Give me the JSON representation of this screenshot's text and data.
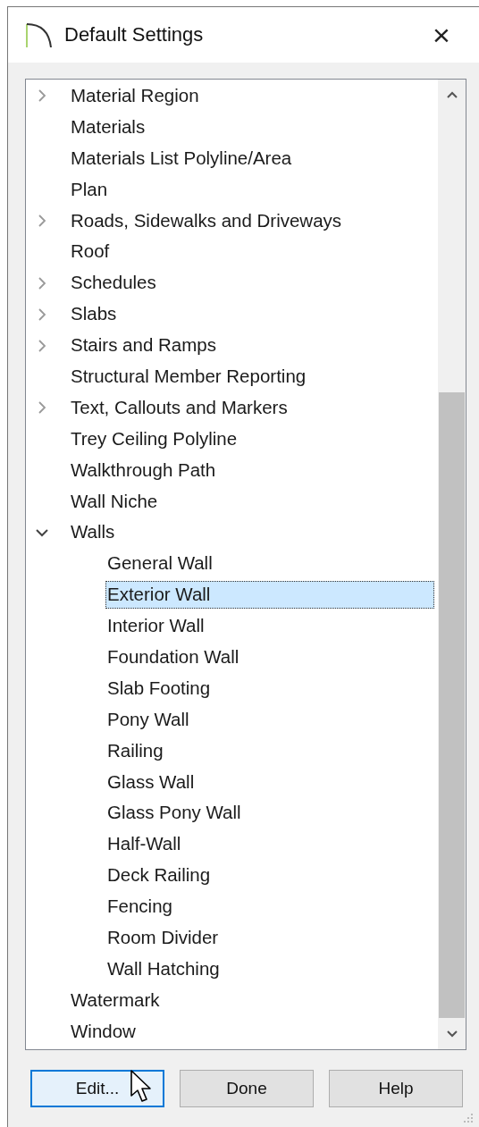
{
  "window": {
    "title": "Default Settings",
    "close": "×"
  },
  "tree": [
    {
      "label": "Material Region",
      "expanded": false,
      "selected": false
    },
    {
      "label": "Materials",
      "selected": false
    },
    {
      "label": "Materials List Polyline/Area",
      "selected": false
    },
    {
      "label": "Plan",
      "selected": false
    },
    {
      "label": "Roads, Sidewalks and Driveways",
      "expanded": false,
      "selected": false
    },
    {
      "label": "Roof",
      "selected": false
    },
    {
      "label": "Schedules",
      "expanded": false,
      "selected": false
    },
    {
      "label": "Slabs",
      "expanded": false,
      "selected": false
    },
    {
      "label": "Stairs and Ramps",
      "expanded": false,
      "selected": false
    },
    {
      "label": "Structural Member Reporting",
      "selected": false
    },
    {
      "label": "Text, Callouts and Markers",
      "expanded": false,
      "selected": false
    },
    {
      "label": "Trey Ceiling Polyline",
      "selected": false
    },
    {
      "label": "Walkthrough Path",
      "selected": false
    },
    {
      "label": "Wall Niche",
      "selected": false
    },
    {
      "label": "Walls",
      "expanded": true,
      "selected": false,
      "children": [
        {
          "label": "General Wall",
          "selected": false
        },
        {
          "label": "Exterior Wall",
          "selected": true
        },
        {
          "label": "Interior Wall",
          "selected": false
        },
        {
          "label": "Foundation Wall",
          "selected": false
        },
        {
          "label": "Slab Footing",
          "selected": false
        },
        {
          "label": "Pony Wall",
          "selected": false
        },
        {
          "label": "Railing",
          "selected": false
        },
        {
          "label": "Glass Wall",
          "selected": false
        },
        {
          "label": "Glass Pony Wall",
          "selected": false
        },
        {
          "label": "Half-Wall",
          "selected": false
        },
        {
          "label": "Deck Railing",
          "selected": false
        },
        {
          "label": "Fencing",
          "selected": false
        },
        {
          "label": "Room Divider",
          "selected": false
        },
        {
          "label": "Wall Hatching",
          "selected": false
        }
      ]
    },
    {
      "label": "Watermark",
      "selected": false
    },
    {
      "label": "Window",
      "selected": false
    }
  ],
  "buttons": [
    {
      "label": "Edit...",
      "focused": true
    },
    {
      "label": "Done",
      "focused": false
    },
    {
      "label": "Help",
      "focused": false
    }
  ]
}
